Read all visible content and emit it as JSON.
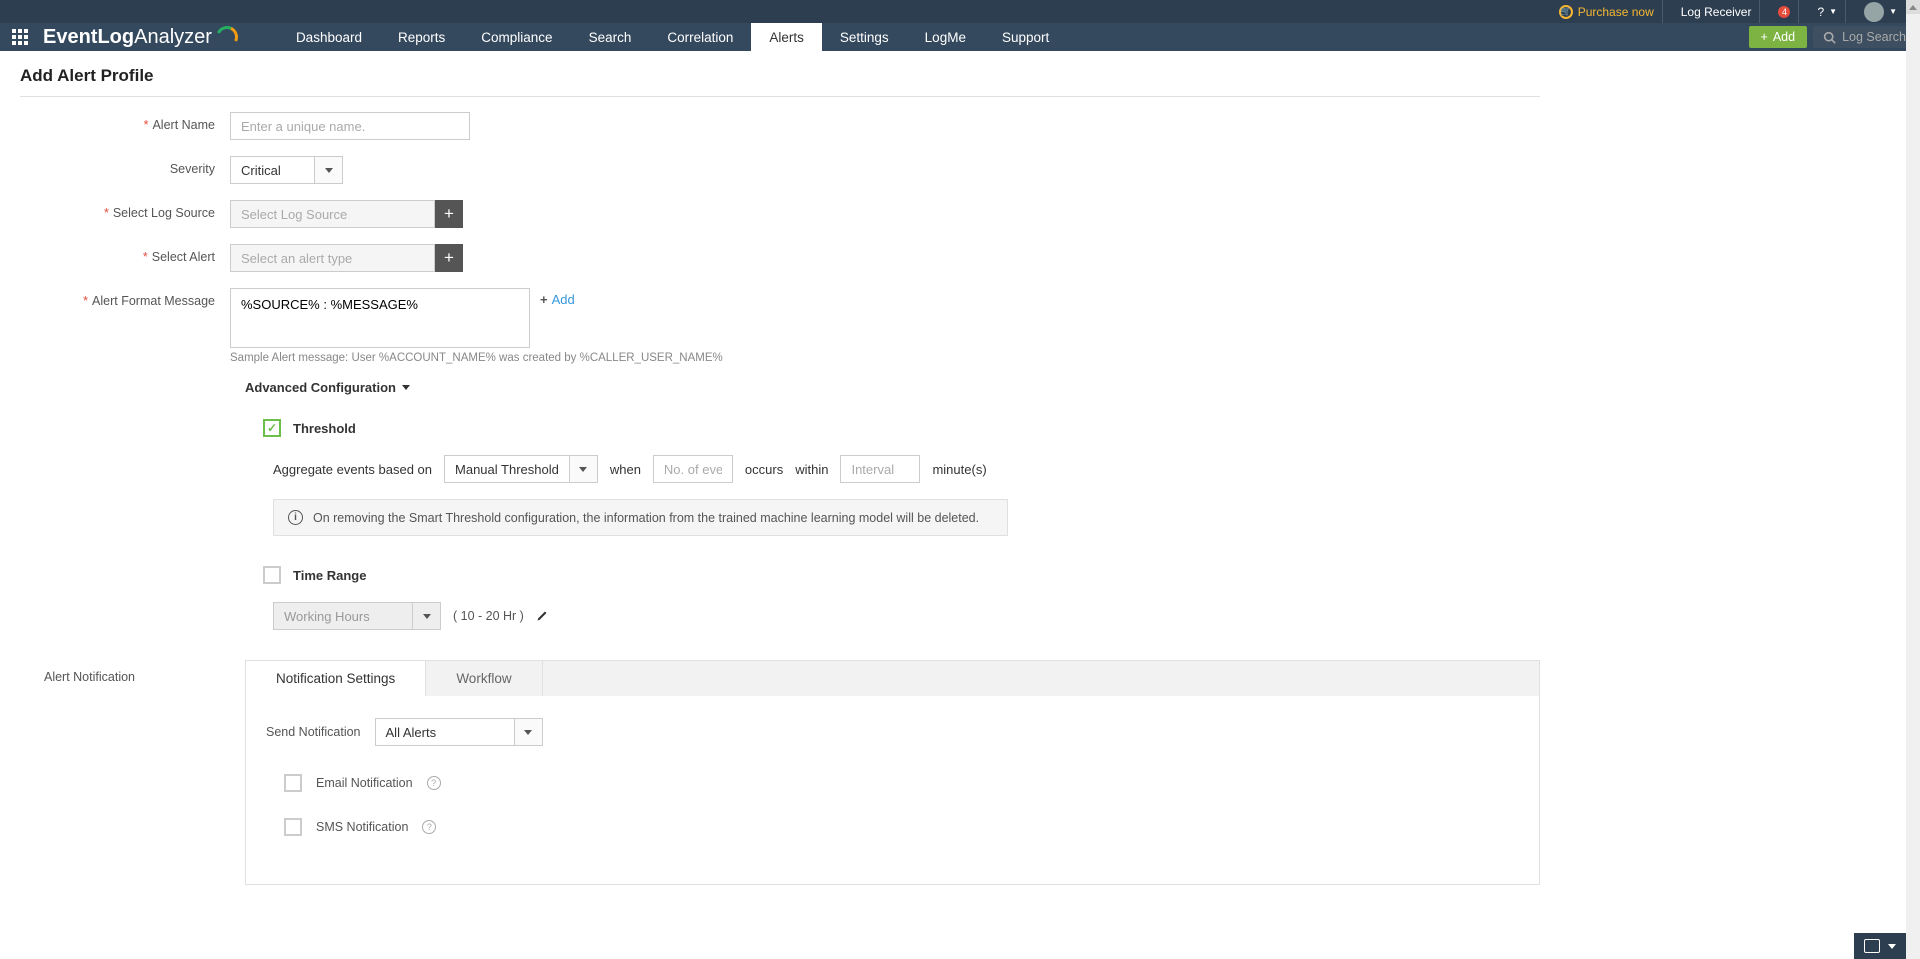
{
  "top_bar": {
    "purchase": "Purchase now",
    "log_receiver": "Log Receiver",
    "bell_count": "4",
    "help": "?"
  },
  "nav": {
    "logo_bold": "EventLog",
    "logo_light": " Analyzer",
    "items": [
      "Dashboard",
      "Reports",
      "Compliance",
      "Search",
      "Correlation",
      "Alerts",
      "Settings",
      "LogMe",
      "Support"
    ],
    "active_index": 5,
    "add_btn": "Add",
    "log_search": "Log Search"
  },
  "page": {
    "title": "Add Alert Profile"
  },
  "form": {
    "alert_name": {
      "label": "Alert Name",
      "placeholder": "Enter a unique name."
    },
    "severity": {
      "label": "Severity",
      "value": "Critical"
    },
    "log_source": {
      "label": "Select Log Source",
      "placeholder": "Select Log Source"
    },
    "select_alert": {
      "label": "Select Alert",
      "placeholder": "Select an alert type"
    },
    "alert_format": {
      "label": "Alert Format Message",
      "value": "%SOURCE% : %MESSAGE%",
      "hint": "Sample Alert message: User %ACCOUNT_NAME% was created by %CALLER_USER_NAME%",
      "add_link": "Add"
    }
  },
  "advanced": {
    "header": "Advanced Configuration",
    "threshold": {
      "label": "Threshold",
      "aggregate_label": "Aggregate events based on",
      "aggregate_value": "Manual Threshold",
      "when": "when",
      "events_placeholder": "No. of events",
      "occurs": "occurs",
      "within": "within",
      "interval_placeholder": "Interval",
      "minutes": "minute(s)",
      "info": "On removing the Smart Threshold configuration, the information from the trained machine learning model will be deleted."
    },
    "time_range": {
      "label": "Time Range",
      "value": "Working Hours",
      "hours": "( 10 - 20 Hr )"
    }
  },
  "notification": {
    "label": "Alert Notification",
    "tabs": [
      "Notification Settings",
      "Workflow"
    ],
    "active_tab": 0,
    "send_notif_label": "Send Notification",
    "send_notif_value": "All Alerts",
    "email_label": "Email Notification",
    "sms_label": "SMS Notification"
  }
}
